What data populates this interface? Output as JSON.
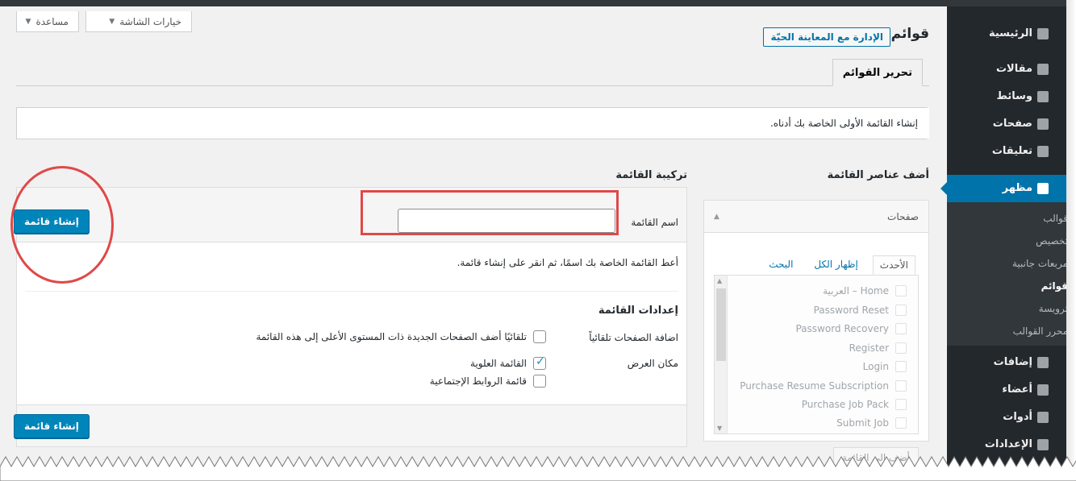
{
  "screen_options": {
    "screen_options_label": "خيارات الشاشة",
    "help_label": "مساعدة"
  },
  "header": {
    "title": "قوائم",
    "live_preview_button": "الإدارة مع المعاينة الحيّة"
  },
  "tabs": {
    "edit_menus": "تحرير القوائم"
  },
  "notice": {
    "text": "إنشاء القائمة الأولى الخاصة بك أدناه."
  },
  "add_items": {
    "heading": "أضف عناصر القائمة",
    "pages_section": "صفحات",
    "tabs": [
      "الأحدث",
      "إظهار الكل",
      "البحث"
    ],
    "pages": [
      "Home – العربية",
      "Password Reset",
      "Password Recovery",
      "Register",
      "Login",
      "Purchase Resume Subscription",
      "Purchase Job Pack",
      "Submit Job"
    ],
    "footer_button": "أضف إلى القائمة"
  },
  "structure": {
    "heading": "تركيبة القائمة",
    "name_label": "اسم القائمة",
    "name_value": "",
    "create_button": "إنشاء قائمة",
    "help_text": "أعط القائمة الخاصة بك اسمًا، ثم انقر على إنشاء قائمة.",
    "settings_title": "إعدادات القائمة",
    "auto_add_label": "اضافة الصفحات تلقائياً",
    "auto_add_option": "تلقائيًا أضف الصفحات الجديدة ذات المستوى الأعلى إلى هذه القائمة",
    "display_location_label": "مكان العرض",
    "locations": [
      {
        "label": "القائمة العلوية",
        "checked": true
      },
      {
        "label": "قائمة الروابط الإجتماعية",
        "checked": false
      }
    ]
  },
  "sidebar": {
    "items": [
      "الرئيسية",
      "مقالات",
      "وسائط",
      "صفحات",
      "تعليقات",
      "مظهر",
      "إضافات",
      "أعضاء",
      "أدوات",
      "الإعدادات"
    ],
    "appearance_sub": [
      "قوالب",
      "تخصيص",
      "مربعات جانبية",
      "قوائم",
      "ترويسة",
      "محرر القوالب"
    ],
    "active_item": "مظهر"
  },
  "colors": {
    "accent": "#0073aa",
    "primary_button": "#0085ba",
    "annotation": "#e04848",
    "sidebar_bg": "#23282d"
  }
}
